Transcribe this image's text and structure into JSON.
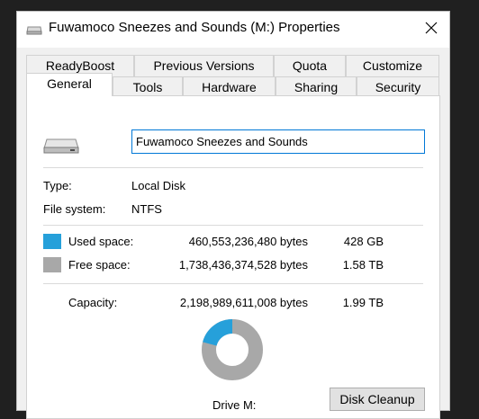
{
  "window": {
    "title": "Fuwamoco Sneezes and Sounds (M:) Properties",
    "icon": "drive-icon",
    "close_icon": "close-icon"
  },
  "tabs": {
    "row1": [
      "ReadyBoost",
      "Previous Versions",
      "Quota",
      "Customize"
    ],
    "row2": [
      "General",
      "Tools",
      "Hardware",
      "Sharing",
      "Security"
    ],
    "active": "General"
  },
  "general": {
    "drive_name": "Fuwamoco Sneezes and Sounds",
    "type_label": "Type:",
    "type_value": "Local Disk",
    "fs_label": "File system:",
    "fs_value": "NTFS",
    "used_label": "Used space:",
    "used_bytes": "460,553,236,480 bytes",
    "used_short": "428 GB",
    "free_label": "Free space:",
    "free_bytes": "1,738,436,374,528 bytes",
    "free_short": "1.58 TB",
    "capacity_label": "Capacity:",
    "capacity_bytes": "2,198,989,611,008 bytes",
    "capacity_short": "1.99 TB",
    "drive_label": "Drive M:",
    "cleanup_button": "Disk Cleanup",
    "used_fraction": 0.2094,
    "colors": {
      "used": "#26a0da",
      "free": "#a8a8a8"
    }
  }
}
